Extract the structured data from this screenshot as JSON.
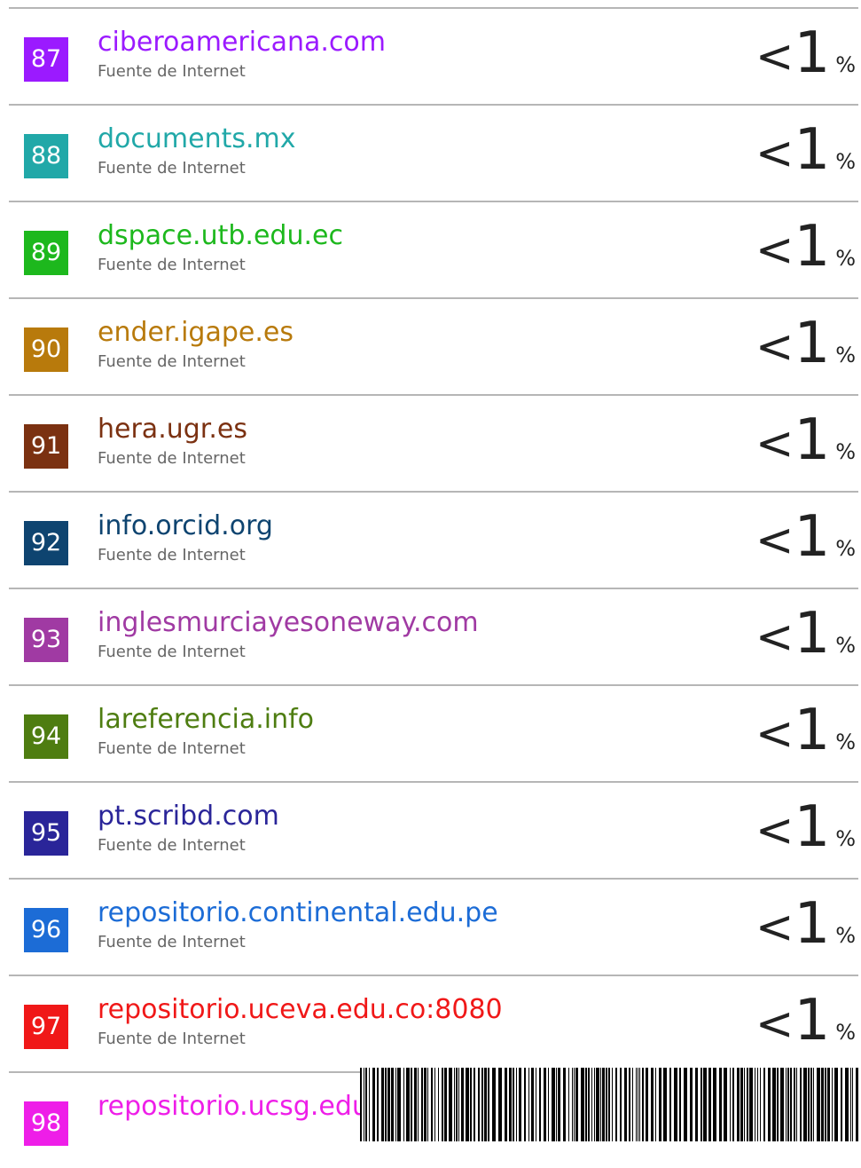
{
  "sources": [
    {
      "number": "87",
      "source": "ciberoamericana.com",
      "type": "Fuente de Internet",
      "lt": "<",
      "value": "1",
      "unit": "%",
      "color": "#9b1aff"
    },
    {
      "number": "88",
      "source": "documents.mx",
      "type": "Fuente de Internet",
      "lt": "<",
      "value": "1",
      "unit": "%",
      "color": "#21a8a8"
    },
    {
      "number": "89",
      "source": "dspace.utb.edu.ec",
      "type": "Fuente de Internet",
      "lt": "<",
      "value": "1",
      "unit": "%",
      "color": "#1db81d"
    },
    {
      "number": "90",
      "source": "ender.igape.es",
      "type": "Fuente de Internet",
      "lt": "<",
      "value": "1",
      "unit": "%",
      "color": "#b87a0c"
    },
    {
      "number": "91",
      "source": "hera.ugr.es",
      "type": "Fuente de Internet",
      "lt": "<",
      "value": "1",
      "unit": "%",
      "color": "#7b3111"
    },
    {
      "number": "92",
      "source": "info.orcid.org",
      "type": "Fuente de Internet",
      "lt": "<",
      "value": "1",
      "unit": "%",
      "color": "#0e4470"
    },
    {
      "number": "93",
      "source": "inglesmurciayesoneway.com",
      "type": "Fuente de Internet",
      "lt": "<",
      "value": "1",
      "unit": "%",
      "color": "#a03aa3"
    },
    {
      "number": "94",
      "source": "lareferencia.info",
      "type": "Fuente de Internet",
      "lt": "<",
      "value": "1",
      "unit": "%",
      "color": "#4e7d11"
    },
    {
      "number": "95",
      "source": "pt.scribd.com",
      "type": "Fuente de Internet",
      "lt": "<",
      "value": "1",
      "unit": "%",
      "color": "#2a2599"
    },
    {
      "number": "96",
      "source": "repositorio.continental.edu.pe",
      "type": "Fuente de Internet",
      "lt": "<",
      "value": "1",
      "unit": "%",
      "color": "#1c6cd6"
    },
    {
      "number": "97",
      "source": "repositorio.uceva.edu.co:8080",
      "type": "Fuente de Internet",
      "lt": "<",
      "value": "1",
      "unit": "%",
      "color": "#f01818"
    },
    {
      "number": "98",
      "source": "repositorio.ucsg.edu.ec",
      "type": "",
      "lt": "",
      "value": "",
      "unit": "",
      "color": "#ee1ee8"
    }
  ]
}
